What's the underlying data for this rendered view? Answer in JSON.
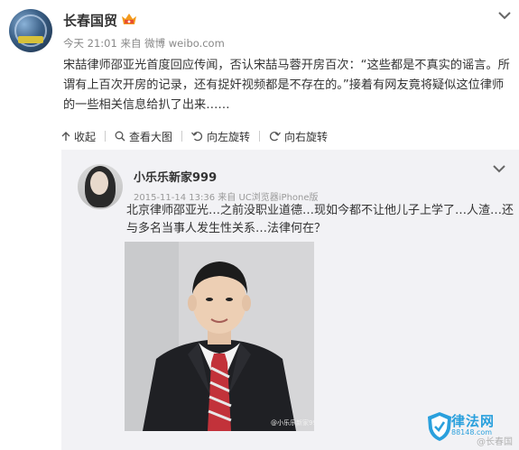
{
  "post": {
    "author": "长春国贸",
    "meta_time": "今天 21:01",
    "meta_from": "来自",
    "meta_source": "微博 weibo.com",
    "content": "宋喆律师邵亚光首度回应传闻，否认宋喆马蓉开房百次：“这些都是不真实的谣言。所谓有上百次开房的记录，还有捉奸视频都是不存在的。”接着有网友竟将疑似这位律师的一些相关信息给扒了出来……",
    "actions": {
      "collapse": "收起",
      "view_large": "查看大图",
      "rotate_left": "向左旋转",
      "rotate_right": "向右旋转"
    }
  },
  "repost": {
    "author": "小乐乐新家999",
    "meta": "2015-11-14 13:36 来自 UC浏览器iPhone版",
    "content": "北京律师邵亚光…之前没职业道德…现如今都不让他儿子上学了…人渣…还与多名当事人发生性关系…法律何在？",
    "photo_watermark": "@小乐乐新家999"
  },
  "watermark": {
    "site_name": "律法网",
    "site_url": "88148.com",
    "signature": "@长春国贸"
  },
  "colors": {
    "link": "#eb7350",
    "watermark": "#2aa0dd"
  },
  "icons": {
    "vip": "vip-crown-icon",
    "more": "chevron-down-icon",
    "collapse": "arrow-up-icon",
    "view_large": "magnifier-icon",
    "rotate_left": "rotate-left-icon",
    "rotate_right": "rotate-right-icon"
  }
}
